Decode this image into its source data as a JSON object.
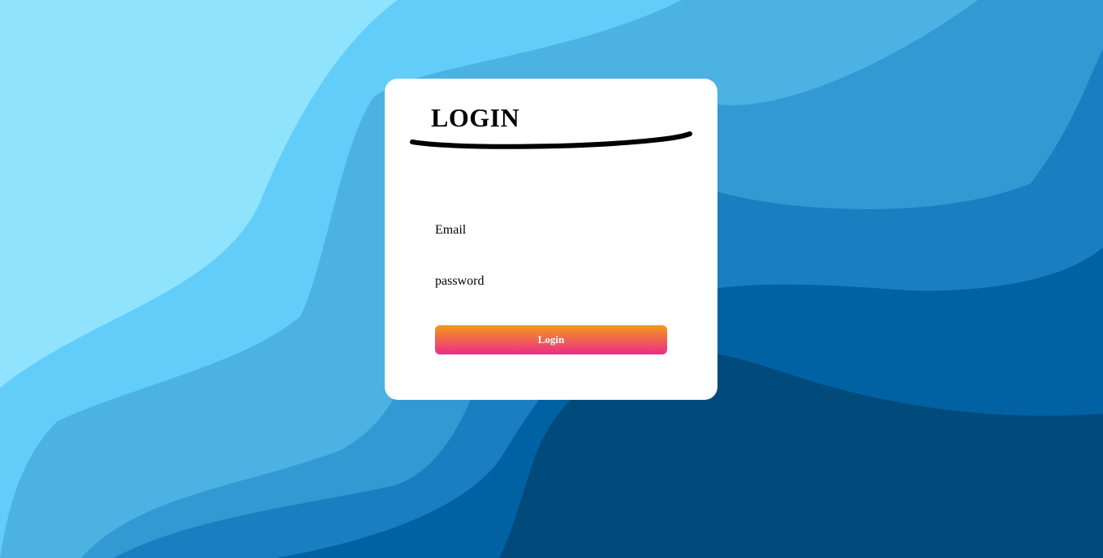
{
  "background": {
    "colors": [
      "#8fe3fd",
      "#63cdfa",
      "#4bb2e3",
      "#3399d3",
      "#1a7fc1",
      "#0062a3",
      "#004a7c"
    ]
  },
  "login_card": {
    "title": "LOGIN",
    "email_placeholder": "Email",
    "password_placeholder": "password",
    "submit_label": "Login",
    "button_gradient": [
      "#f39a1a",
      "#ee2a8a"
    ]
  }
}
